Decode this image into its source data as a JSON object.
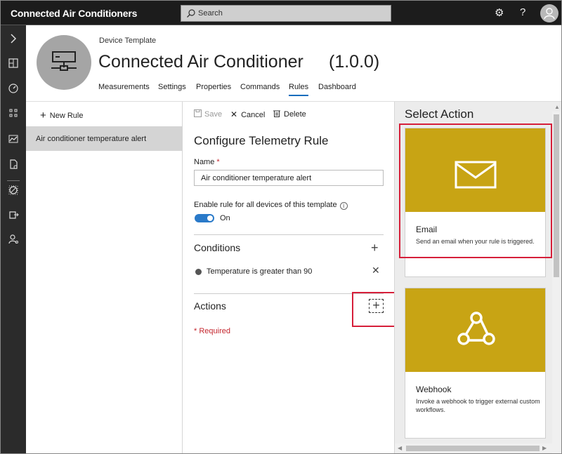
{
  "app": {
    "title": "Connected Air Conditioners"
  },
  "search": {
    "placeholder": "Search"
  },
  "header_icons": [
    "settings-icon",
    "help-icon",
    "avatar-icon"
  ],
  "rail_icons": [
    "chevron-right-icon",
    "dashboard-icon",
    "devices-icon",
    "apps-icon",
    "analytics-icon",
    "device-template-icon",
    "rules-icon",
    "export-icon",
    "admin-icon"
  ],
  "header": {
    "breadcrumb": "Device Template",
    "title": "Connected Air Conditioner",
    "version": "(1.0.0)",
    "tabs": [
      "Measurements",
      "Settings",
      "Properties",
      "Commands",
      "Rules",
      "Dashboard"
    ],
    "active_tab": "Rules"
  },
  "rules_list": {
    "new_rule_label": "New Rule",
    "items": [
      "Air conditioner temperature alert"
    ]
  },
  "toolbar": {
    "save_label": "Save",
    "cancel_label": "Cancel",
    "delete_label": "Delete"
  },
  "form": {
    "title": "Configure Telemetry Rule",
    "name_label": "Name",
    "name_required_mark": "*",
    "name_value": "Air conditioner temperature alert",
    "enable_label": "Enable rule for all devices of this template",
    "info_glyph": "i",
    "enable_state": "On",
    "conditions_heading": "Conditions",
    "conditions": [
      "Temperature is greater than 90"
    ],
    "actions_heading": "Actions",
    "required_note": "* Required"
  },
  "select_action": {
    "title": "Select Action",
    "cards": [
      {
        "title": "Email",
        "description": "Send an email when your rule is triggered.",
        "icon": "envelope-icon"
      },
      {
        "title": "Webhook",
        "description": "Invoke a webhook to trigger external custom workflows.",
        "icon": "webhook-icon"
      }
    ]
  },
  "colors": {
    "topbar": "#1c1c1c",
    "rail": "#2b2b2b",
    "card_banner": "#c8a414",
    "highlight": "#d61f3a",
    "toggle_on": "#2a7ac9"
  }
}
